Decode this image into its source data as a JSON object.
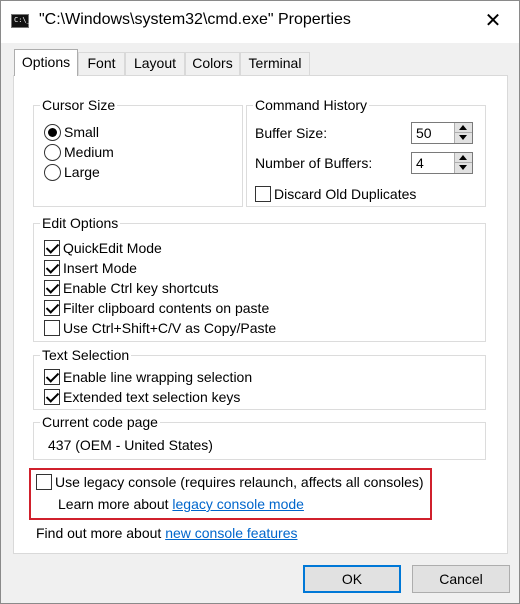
{
  "window": {
    "title": "\"C:\\Windows\\system32\\cmd.exe\" Properties",
    "icon_text": "C:\\_",
    "close_glyph": "✕"
  },
  "tabs": [
    {
      "label": "Options",
      "active": true
    },
    {
      "label": "Font"
    },
    {
      "label": "Layout"
    },
    {
      "label": "Colors"
    },
    {
      "label": "Terminal"
    }
  ],
  "cursor_size": {
    "title": "Cursor Size",
    "options": [
      {
        "label": "Small",
        "selected": true
      },
      {
        "label": "Medium",
        "selected": false
      },
      {
        "label": "Large",
        "selected": false
      }
    ]
  },
  "command_history": {
    "title": "Command History",
    "buffer_size_label": "Buffer Size:",
    "buffer_size_value": "50",
    "num_buffers_label": "Number of Buffers:",
    "num_buffers_value": "4",
    "discard_label": "Discard Old Duplicates",
    "discard_checked": false
  },
  "edit_options": {
    "title": "Edit Options",
    "items": [
      {
        "label": "QuickEdit Mode",
        "checked": true
      },
      {
        "label": "Insert Mode",
        "checked": true
      },
      {
        "label": "Enable Ctrl key shortcuts",
        "checked": true
      },
      {
        "label": "Filter clipboard contents on paste",
        "checked": true
      },
      {
        "label": "Use Ctrl+Shift+C/V as Copy/Paste",
        "checked": false
      }
    ]
  },
  "text_selection": {
    "title": "Text Selection",
    "items": [
      {
        "label": "Enable line wrapping selection",
        "checked": true
      },
      {
        "label": "Extended text selection keys",
        "checked": true
      }
    ]
  },
  "code_page": {
    "title": "Current code page",
    "value": "437  (OEM - United States)"
  },
  "legacy": {
    "label": "Use legacy console (requires relaunch, affects all consoles)",
    "checked": false,
    "learn_prefix": "Learn more about ",
    "learn_link": "legacy console mode"
  },
  "footer": {
    "prefix": "Find out more about ",
    "link": "new console features"
  },
  "buttons": {
    "ok": "OK",
    "cancel": "Cancel"
  },
  "colors": {
    "highlight": "#d0202c",
    "link": "#0066cc",
    "default_button_border": "#0078d7"
  }
}
